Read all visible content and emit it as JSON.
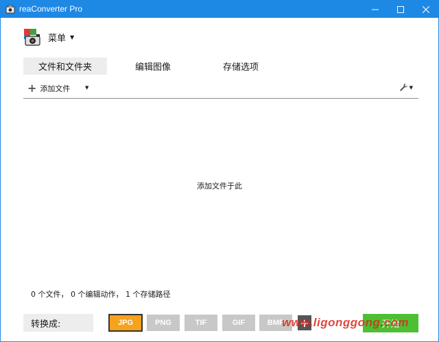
{
  "titlebar": {
    "title": "reaConverter Pro"
  },
  "menu": {
    "label": "菜单"
  },
  "tabs": [
    {
      "label": "文件和文件夹",
      "active": true
    },
    {
      "label": "编辑图像",
      "active": false
    },
    {
      "label": "存储选项",
      "active": false
    }
  ],
  "toolbar": {
    "add_files_label": "添加文件"
  },
  "drop_hint": "添加文件于此",
  "status": "0 个文件， 0 个编辑动作， 1 个存储路径",
  "bottom": {
    "convert_label": "转换成:",
    "formats": [
      "JPG",
      "PNG",
      "TIF",
      "GIF",
      "BMP"
    ],
    "selected_format": "JPG",
    "add_format_label": "+",
    "start_label": "开始"
  },
  "watermark": "www.ligonggong.com",
  "colors": {
    "titlebar": "#1e88e5",
    "selected_format": "#f7a21c",
    "start": "#4cbf33"
  }
}
